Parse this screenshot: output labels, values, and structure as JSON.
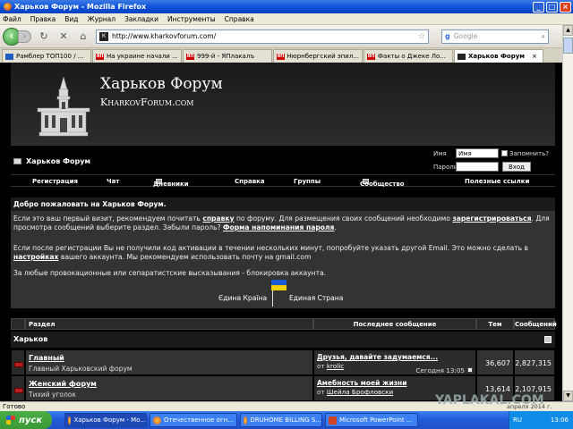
{
  "window": {
    "title": "Харьков Форум - Mozilla Firefox",
    "min": "_",
    "max": "□",
    "close": "×"
  },
  "menu": [
    "Файл",
    "Правка",
    "Вид",
    "Журнал",
    "Закладки",
    "Инструменты",
    "Справка"
  ],
  "toolbar": {
    "url": "http://www.kharkovforum.com/",
    "search_placeholder": "Google",
    "search_engine": "g"
  },
  "tabs": [
    {
      "label": "Рамблер ТОП100 / ..."
    },
    {
      "label": "На украине начали ..."
    },
    {
      "label": "999-й - ЯПлакалъ"
    },
    {
      "label": "Нюрнбергский эпил..."
    },
    {
      "label": "Факты о Джеке Ло..."
    },
    {
      "label": "Харьков Форум",
      "active": true
    }
  ],
  "site": {
    "title": "Харьков Форум",
    "subtitle": "KharkovForum.com"
  },
  "header": {
    "home": "Харьков Форум"
  },
  "login": {
    "user_label": "Имя",
    "user_value": "Имя",
    "remember": "Запомнить?",
    "pass_label": "Пароль",
    "submit": "Вход"
  },
  "nav": [
    "Регистрация",
    "Чат",
    "Дневники",
    "Справка",
    "Группы",
    "Сообщество",
    "Полезные ссылки"
  ],
  "welcome": {
    "heading": "Добро пожаловать на Харьков Форум.",
    "p1a": "Если это ваш первый визит, рекомендуем почитать ",
    "p1_link1": "справку",
    "p1b": " по форуму. Для размещения своих сообщений необходимо ",
    "p1_link2": "зарегистрироваться",
    "p1c": ". Для просмотра сообщений выберите раздел. Забыли пароль? ",
    "p1_link3": "Форма напоминания пароля",
    "p1d": ".",
    "p2a": "Если после регистрации Вы не получили код активации в течении нескольких минут, попробуйте указать другой Email. Это можно сделать в ",
    "p2_link": "настройках",
    "p2b": " вашего аккаунта. Мы рекомендуем использовать почту на gmail.com",
    "p3": "За любые провокационные или сепаратистские высказывания - блокировка аккаунта.",
    "ukr": "Єдина Країна",
    "rus": "Единая Страна"
  },
  "forum_table": {
    "headers": {
      "section": "Раздел",
      "last": "Последнее сообщение",
      "topics": "Тем",
      "posts": "Сообщений"
    },
    "category": "Харьков",
    "rows": [
      {
        "name": "Главный",
        "desc": "Главный Харьковский форум",
        "last_title": "Друзья, давайте задумаемся...",
        "by_label": "от ",
        "last_by": "krolic",
        "last_date": "Сегодня 13:05",
        "topics": "36,607",
        "posts": "2,827,315"
      },
      {
        "name": "Женский форум",
        "desc": "Тихий уголок",
        "last_title": "Амебность моей жизни",
        "by_label": "от ",
        "last_by": "Шейла Брофловски",
        "last_date": "",
        "topics": "13,614",
        "posts": "2,107,915"
      }
    ]
  },
  "status": {
    "text": "Готово"
  },
  "watermark": {
    "text": "YAPLAKAL.COM",
    "date": "апреля 2014 г."
  },
  "taskbar": {
    "start": "пуск",
    "items": [
      "Харьков Форум - Mo...",
      "Отечественное огн...",
      "DRUHOME BILLING S...",
      "Microsoft PowerPoint ..."
    ],
    "lang": "RU",
    "clock": "13:06"
  }
}
